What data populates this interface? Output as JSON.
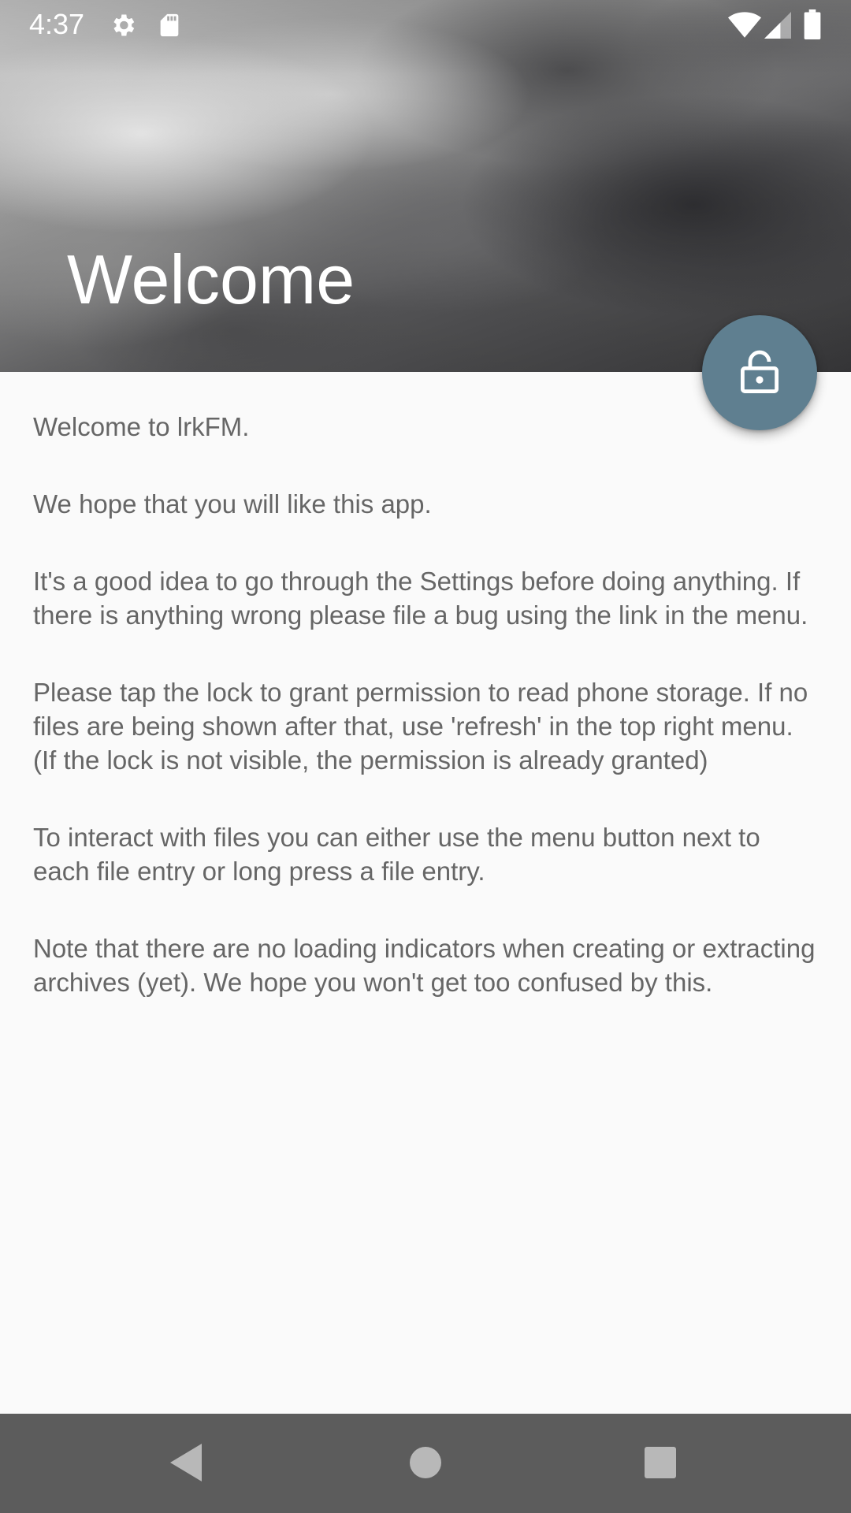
{
  "status_bar": {
    "time": "4:37",
    "icons": [
      "gear-icon",
      "sd-card-icon",
      "wifi-icon",
      "signal-icon",
      "battery-icon"
    ]
  },
  "header": {
    "title": "Welcome"
  },
  "fab": {
    "icon": "lock-open-icon",
    "color": "#5f7f90"
  },
  "content": {
    "paragraphs": [
      "Welcome to lrkFM.",
      "We hope that you will like this app.",
      "It's a good idea to go through the Settings before doing anything. If there is anything wrong please file a bug using the link in the menu.",
      "Please tap the lock to grant permission to read phone storage. If no files are being shown after that, use 'refresh' in the top right menu. (If the lock is not visible, the permission is already granted)",
      "To interact with files you can either use the menu button next to each file entry or long press a file entry.",
      "Note that there are no loading indicators when creating or extracting archives (yet). We hope you won't get too confused by this."
    ]
  },
  "nav_bar": {
    "buttons": [
      "back-icon",
      "home-icon",
      "recents-icon"
    ],
    "color": "#5c5c5c"
  }
}
